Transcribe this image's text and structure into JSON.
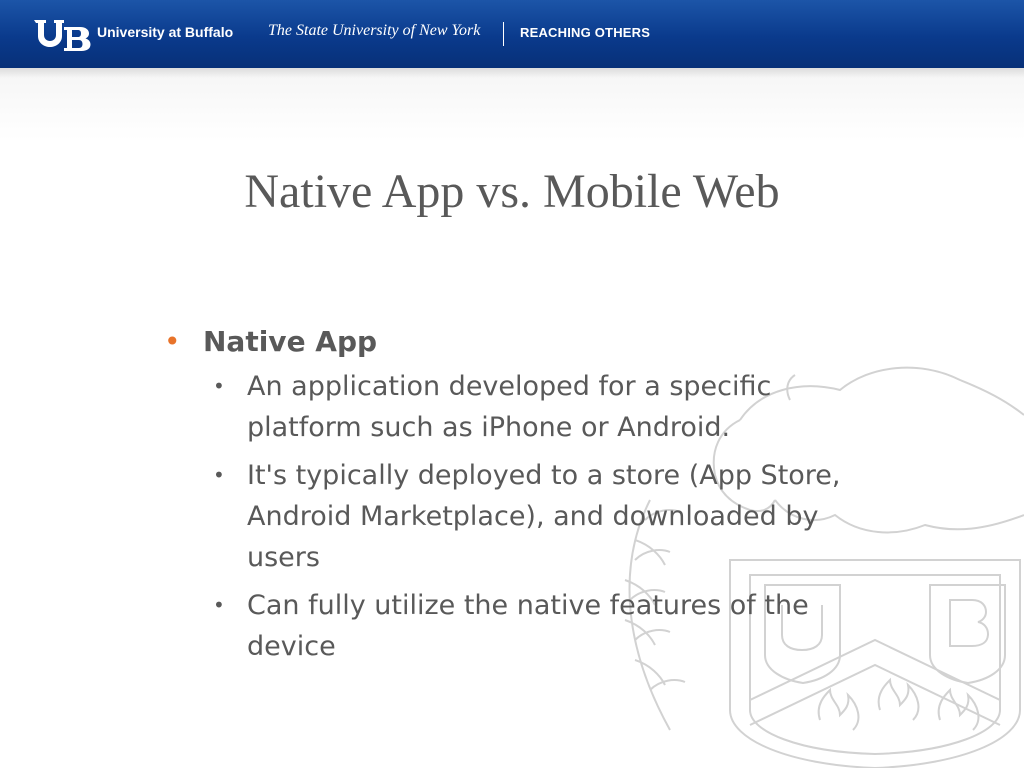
{
  "header": {
    "logo_text": "UB",
    "university_name": "University at Buffalo",
    "state_name": "The State University of New York",
    "tagline": "REACHING OTHERS"
  },
  "slide": {
    "title": "Native App vs. Mobile Web",
    "bullets": [
      {
        "label": "Native App",
        "sub": [
          "An application developed for a specific platform such as iPhone or Android.",
          "It's typically deployed to a store (App Store, Android Marketplace), and downloaded by users",
          "Can fully utilize the native features of the device"
        ]
      }
    ]
  },
  "colors": {
    "header_blue": "#0a3a8c",
    "title_gray": "#595959",
    "bullet_orange": "#e8732a"
  },
  "icons": {
    "logo": "ub-logo",
    "watermark": "ub-seal-watermark"
  }
}
